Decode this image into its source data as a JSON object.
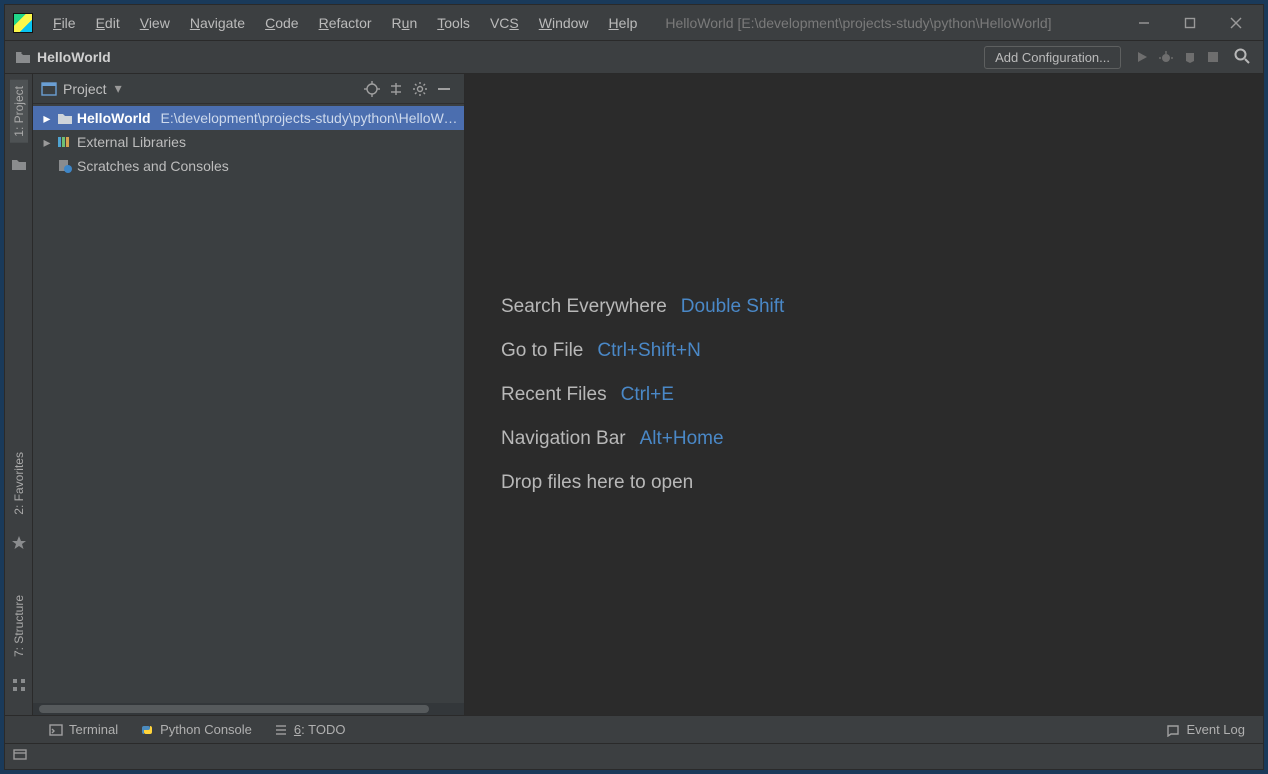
{
  "title_path": "HelloWorld [E:\\development\\projects-study\\python\\HelloWorld]",
  "menu": {
    "items": [
      "File",
      "Edit",
      "View",
      "Navigate",
      "Code",
      "Refactor",
      "Run",
      "Tools",
      "VCS",
      "Window",
      "Help"
    ],
    "mnemonics": [
      "F",
      "E",
      "V",
      "N",
      "C",
      "R",
      "u",
      "T",
      "S",
      "W",
      "H"
    ]
  },
  "breadcrumb": {
    "project": "HelloWorld"
  },
  "toolbar": {
    "config_label": "Add Configuration..."
  },
  "left_tabs": {
    "project": "1: Project",
    "favorites": "2: Favorites",
    "structure": "7: Structure"
  },
  "project_panel": {
    "title": "Project",
    "tree": {
      "root_name": "HelloWorld",
      "root_path": "E:\\development\\projects-study\\python\\HelloWorld",
      "ext_libs": "External Libraries",
      "scratches": "Scratches and Consoles"
    }
  },
  "tips": [
    {
      "label": "Search Everywhere",
      "key": "Double Shift"
    },
    {
      "label": "Go to File",
      "key": "Ctrl+Shift+N"
    },
    {
      "label": "Recent Files",
      "key": "Ctrl+E"
    },
    {
      "label": "Navigation Bar",
      "key": "Alt+Home"
    }
  ],
  "drop_hint": "Drop files here to open",
  "bottom": {
    "terminal": "Terminal",
    "pyconsole": "Python Console",
    "todo": "6: TODO",
    "eventlog": "Event Log"
  }
}
